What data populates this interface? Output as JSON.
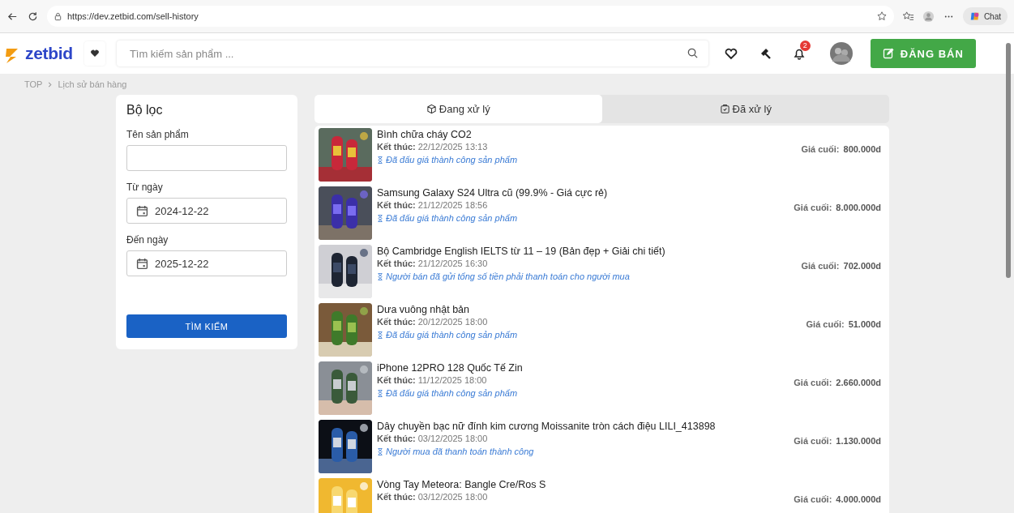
{
  "browser": {
    "url": "https://dev.zetbid.com/sell-history",
    "chat_label": "Chat"
  },
  "header": {
    "logo": "zetbid",
    "search": {
      "placeholder": "Tìm kiếm sản phẩm ..."
    },
    "notification_count": "2",
    "sell_button": "ĐĂNG BÁN"
  },
  "breadcrumb": [
    "TOP",
    "Lịch sử bán hàng"
  ],
  "filter": {
    "title": "Bộ lọc",
    "fields": [
      {
        "kind": "text",
        "label": "Tên sản phẩm"
      },
      {
        "kind": "date",
        "label": "Từ ngày",
        "value": "2024-12-22"
      },
      {
        "kind": "date",
        "label": "Đến ngày",
        "value": "2025-12-22"
      }
    ],
    "search_button": "TÌM KIẾM"
  },
  "tabs": [
    {
      "label": "Đang xử lý",
      "selected": true
    },
    {
      "label": "Đã xử lý",
      "selected": false
    }
  ],
  "items": [
    {
      "title": "Bình chữa cháy CO2",
      "end_label": "Kết thúc:",
      "end_time": "22/12/2025 13:13",
      "status": "Đã đấu giá thành công sản phẩm",
      "price_label": "Giá cuối:",
      "price": "800.000d"
    },
    {
      "title": "Samsung Galaxy S24 Ultra cũ (99.9% - Giá cực rẻ)",
      "end_label": "Kết thúc:",
      "end_time": "21/12/2025 18:56",
      "status": "Đã đấu giá thành công sản phẩm",
      "price_label": "Giá cuối:",
      "price": "8.000.000d"
    },
    {
      "title": "Bộ Cambridge English IELTS từ 11 – 19 (Bản đẹp + Giải chi tiết)",
      "end_label": "Kết thúc:",
      "end_time": "21/12/2025 16:30",
      "status": "Người bán đã gửi tổng số tiền phải thanh toán cho người mua",
      "price_label": "Giá cuối:",
      "price": "702.000d"
    },
    {
      "title": "Dưa vuông nhật bản",
      "end_label": "Kết thúc:",
      "end_time": "20/12/2025 18:00",
      "status": "Đã đấu giá thành công sản phẩm",
      "price_label": "Giá cuối:",
      "price": "51.000d"
    },
    {
      "title": "iPhone 12PRO 128 Quốc Tế Zin",
      "end_label": "Kết thúc:",
      "end_time": "11/12/2025 18:00",
      "status": "Đã đấu giá thành công sản phẩm",
      "price_label": "Giá cuối:",
      "price": "2.660.000d"
    },
    {
      "title": "Dây chuyền bạc nữ đính kim cương Moissanite tròn cách điệu LILI_413898",
      "end_label": "Kết thúc:",
      "end_time": "03/12/2025 18:00",
      "status": "Người mua đã thanh toán thành công",
      "price_label": "Giá cuối:",
      "price": "1.130.000d"
    },
    {
      "title": "Vòng Tay Meteora: Bangle Cre/Ros S",
      "end_label": "Kết thúc:",
      "end_time": "03/12/2025 18:00",
      "price_label": "Giá cuối:",
      "price": "4.000.000d"
    }
  ]
}
